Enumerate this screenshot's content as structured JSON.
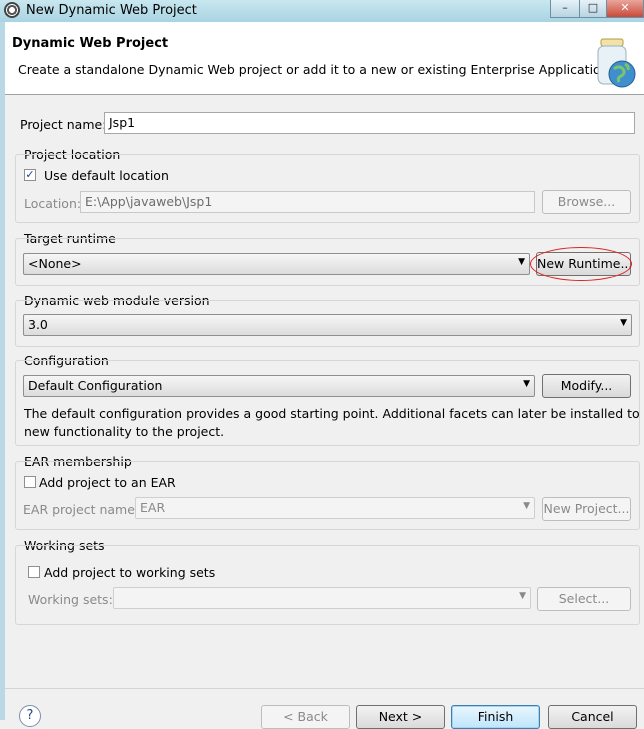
{
  "window": {
    "title": "New Dynamic Web Project"
  },
  "header": {
    "title": "Dynamic Web Project",
    "description": "Create a standalone Dynamic Web project or add it to a new or existing Enterprise Application."
  },
  "project_name": {
    "label": "Project name:",
    "value": "Jsp1"
  },
  "project_location": {
    "group_label": "Project location",
    "use_default_label": "Use default location",
    "use_default_checked": true,
    "location_label": "Location:",
    "location_value": "E:\\App\\javaweb\\Jsp1",
    "browse_label": "Browse..."
  },
  "target_runtime": {
    "group_label": "Target runtime",
    "selected": "<None>",
    "new_runtime_label": "New Runtime..."
  },
  "web_module": {
    "group_label": "Dynamic web module version",
    "selected": "3.0"
  },
  "configuration": {
    "group_label": "Configuration",
    "selected": "Default Configuration",
    "modify_label": "Modify...",
    "description_line1": "The default configuration provides a good starting point. Additional facets can later be installed to add",
    "description_line2": "new functionality to the project."
  },
  "ear": {
    "group_label": "EAR membership",
    "add_label": "Add project to an EAR",
    "add_checked": false,
    "project_name_label": "EAR project name:",
    "project_name_value": "EAR",
    "new_project_label": "New Project..."
  },
  "working_sets": {
    "group_label": "Working sets",
    "add_label": "Add project to working sets",
    "add_checked": false,
    "sets_label": "Working sets:",
    "sets_value": "",
    "select_label": "Select..."
  },
  "footer": {
    "help_symbol": "?",
    "back_label": "< Back",
    "next_label": "Next >",
    "finish_label": "Finish",
    "cancel_label": "Cancel"
  },
  "colors": {
    "annotation_circle": "#dd2222",
    "titlebar": "#b4dbe8"
  }
}
